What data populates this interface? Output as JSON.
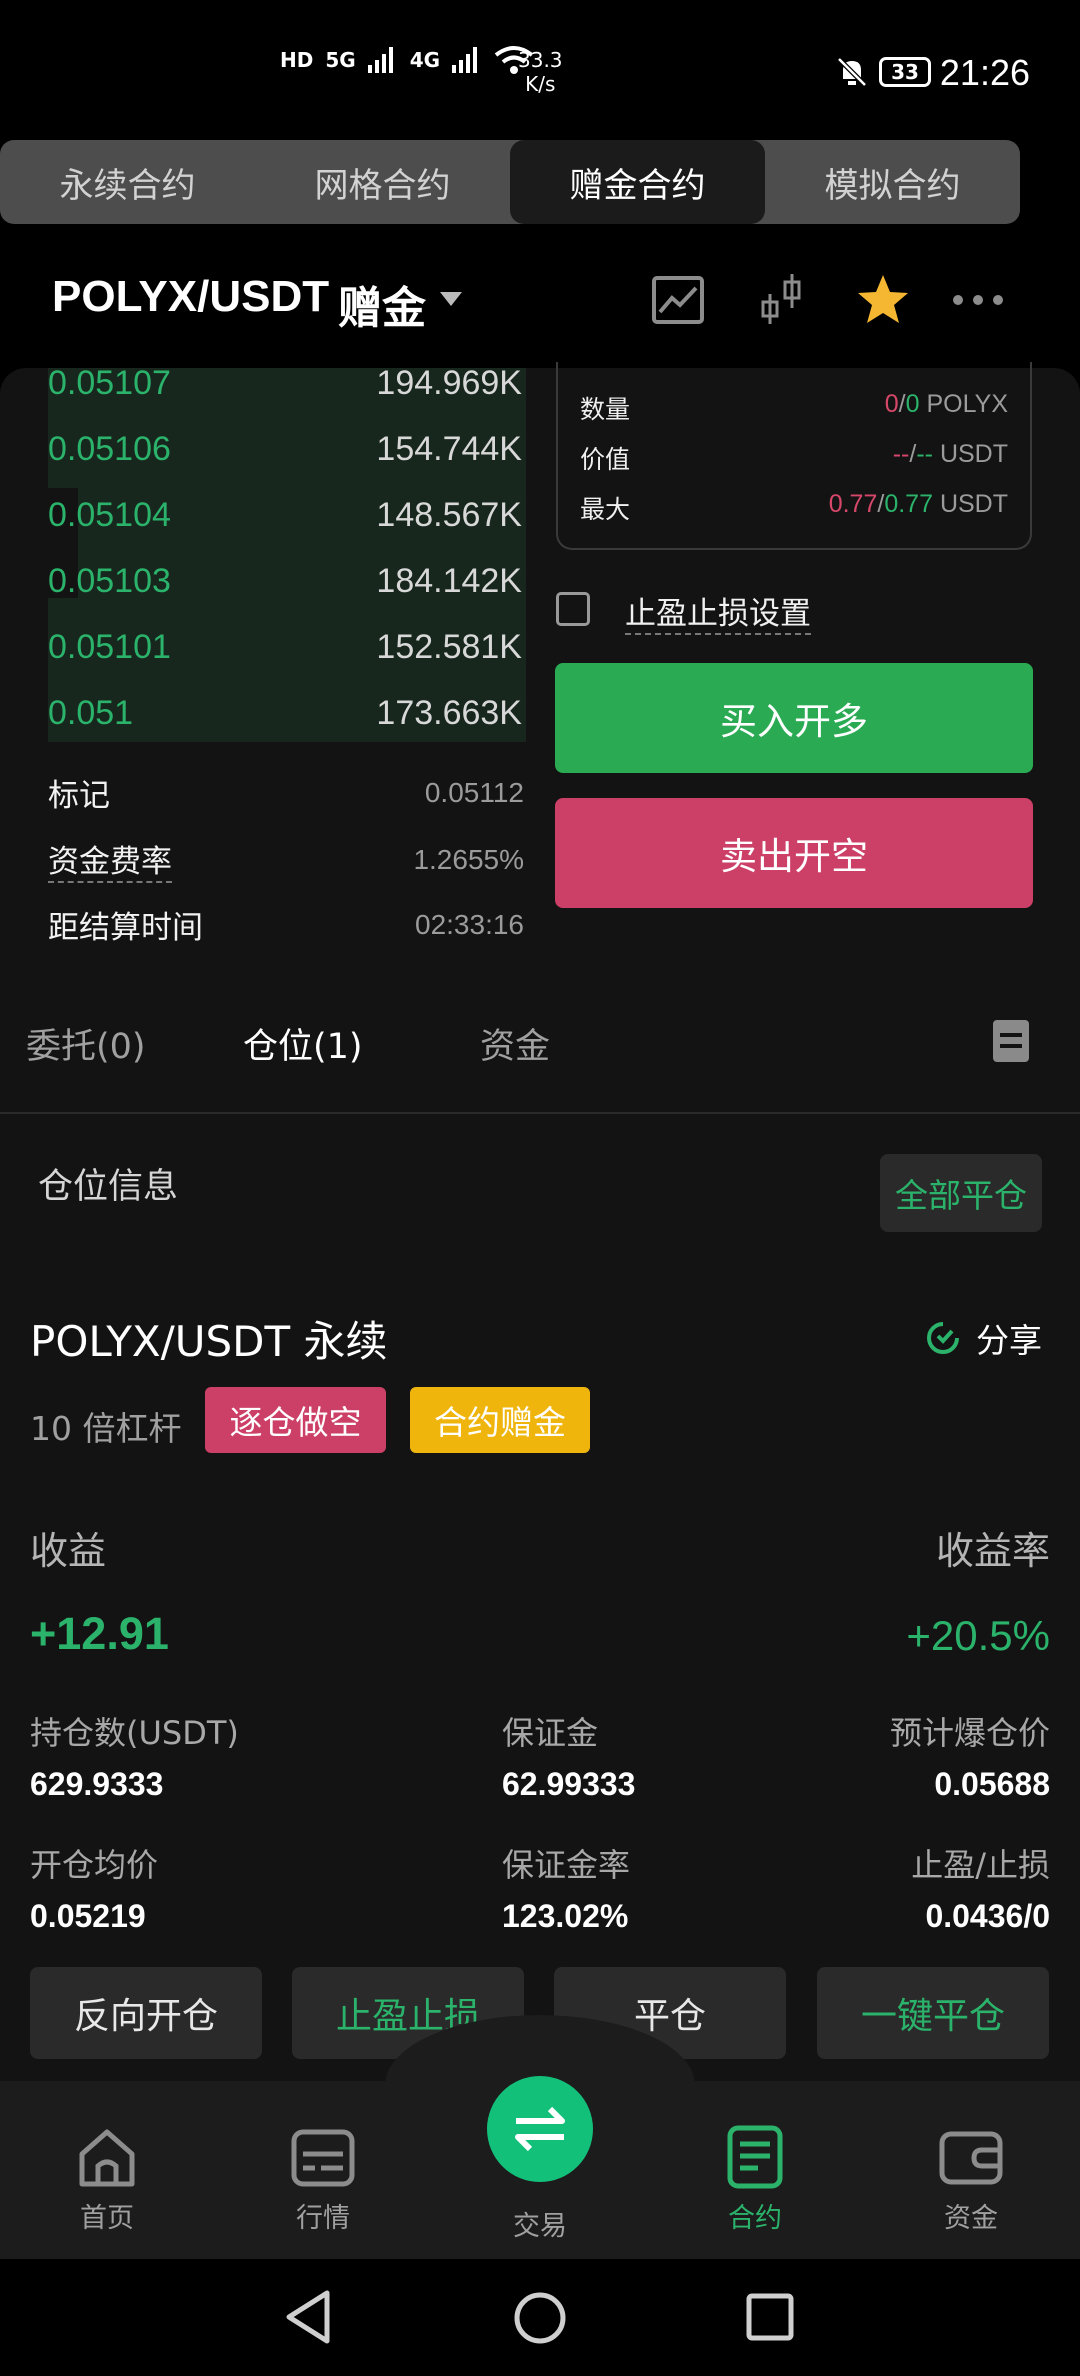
{
  "status_bar": {
    "net1": "HD",
    "net2": "5G",
    "net3": "4G",
    "speed_value": "33.3",
    "speed_unit": "K/s",
    "battery": "33",
    "time": "21:26"
  },
  "contract_tabs": [
    "永续合约",
    "网格合约",
    "赠金合约",
    "模拟合约"
  ],
  "header": {
    "pair": "POLYX/USDT",
    "tag": "赠金"
  },
  "orderbook": [
    {
      "price": "0.05107",
      "qty": "194.969K"
    },
    {
      "price": "0.05106",
      "qty": "154.744K"
    },
    {
      "price": "0.05104",
      "qty": "148.567K"
    },
    {
      "price": "0.05103",
      "qty": "184.142K"
    },
    {
      "price": "0.05101",
      "qty": "152.581K"
    },
    {
      "price": "0.051",
      "qty": "173.663K"
    }
  ],
  "market_info": {
    "mark_label": "标记",
    "mark_value": "0.05112",
    "funding_label": "资金费率",
    "funding_value": "1.2655%",
    "settle_label": "距结算时间",
    "settle_value": "02:33:16"
  },
  "order_box": {
    "qty_label": "数量",
    "qty_a": "0",
    "qty_b": "0",
    "qty_unit": "POLYX",
    "value_label": "价值",
    "value_a": "--",
    "value_b": "--",
    "value_unit": "USDT",
    "max_label": "最大",
    "max_a": "0.77",
    "max_b": "0.77",
    "max_unit": "USDT"
  },
  "tpsl_label": "止盈止损设置",
  "buy_label": "买入开多",
  "sell_label": "卖出开空",
  "position_tabs": {
    "orders": "委托(0)",
    "positions": "仓位(1)",
    "funds": "资金"
  },
  "position": {
    "section_title": "仓位信息",
    "close_all": "全部平仓",
    "symbol": "POLYX/USDT 永续",
    "share": "分享",
    "leverage": "10 倍杠杆",
    "tag_mode": "逐仓做空",
    "tag_bonus": "合约赠金",
    "pnl_label": "收益",
    "pnl_value": "+12.91",
    "roe_label": "收益率",
    "roe_value": "+20.5%",
    "size_label": "持仓数(USDT)",
    "size_value": "629.9333",
    "margin_label": "保证金",
    "margin_value": "62.99333",
    "liq_label": "预计爆仓价",
    "liq_value": "0.05688",
    "entry_label": "开仓均价",
    "entry_value": "0.05219",
    "margin_ratio_label": "保证金率",
    "margin_ratio_value": "123.02%",
    "tpsl_label": "止盈/止损",
    "tpsl_value": "0.0436/0"
  },
  "actions": [
    "反向开仓",
    "止盈止损",
    "平仓",
    "一键平仓"
  ],
  "bottom_nav": [
    "首页",
    "行情",
    "交易",
    "合约",
    "资金"
  ],
  "colors": {
    "green": "#2bb36b",
    "red": "#cc3f66",
    "yellow": "#efb50c",
    "star": "#f5b731"
  }
}
